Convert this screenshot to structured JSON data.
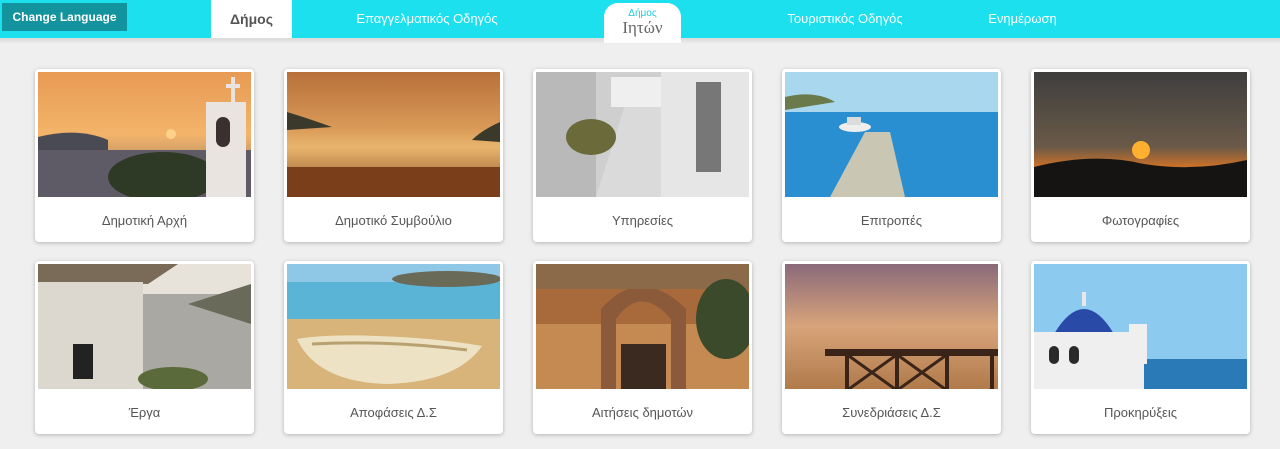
{
  "header": {
    "change_language": "Change Language",
    "nav": [
      {
        "label": "Δήμος",
        "active": true
      },
      {
        "label": "Επαγγελματικός Οδηγός",
        "active": false
      },
      {
        "label": "Τουριστικός Οδηγός",
        "active": false
      },
      {
        "label": "Ενημέρωση",
        "active": false
      }
    ],
    "logo": {
      "small": "Δήμος",
      "big": "Ιητών"
    }
  },
  "cards": [
    {
      "label": "Δημοτική Αρχή",
      "image": "sunset-chapel"
    },
    {
      "label": "Δημοτικό Συμβούλιο",
      "image": "golden-beach"
    },
    {
      "label": "Υπηρεσίες",
      "image": "village-alley"
    },
    {
      "label": "Επιτροπές",
      "image": "harbor-boat"
    },
    {
      "label": "Φωτογραφίες",
      "image": "dark-sunset"
    },
    {
      "label": "Έργα",
      "image": "windmill"
    },
    {
      "label": "Αποφάσεις Δ.Σ",
      "image": "rowboat-beach"
    },
    {
      "label": "Αιτήσεις δημοτών",
      "image": "stone-arch"
    },
    {
      "label": "Συνεδριάσεις Δ.Σ",
      "image": "balcony-view"
    },
    {
      "label": "Προκηρύξεις",
      "image": "blue-dome-church"
    }
  ]
}
